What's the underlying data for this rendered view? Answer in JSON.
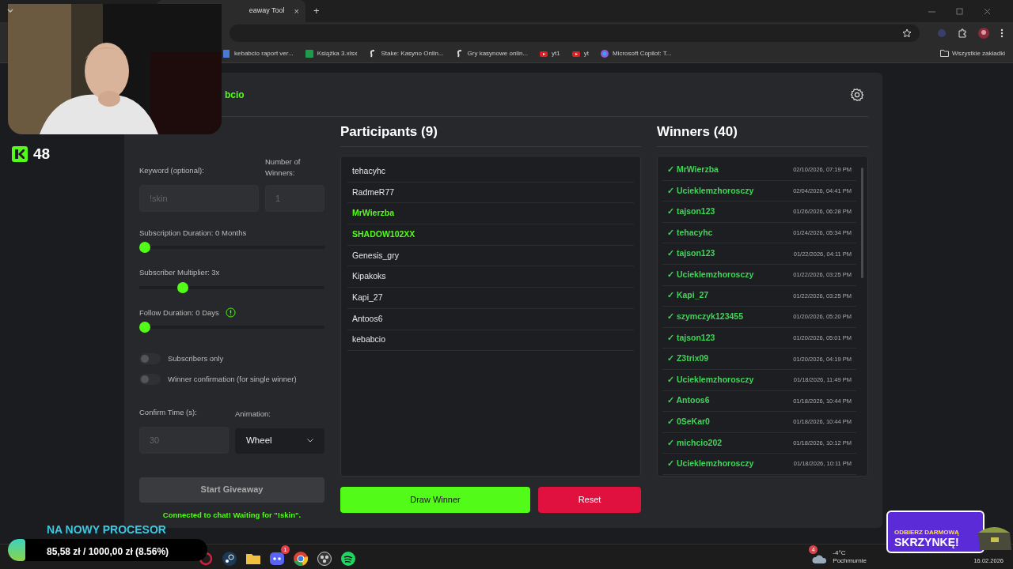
{
  "browser": {
    "tab_title": "eaway Tool",
    "tab_close": "×",
    "new_tab": "+",
    "bookmarks": [
      {
        "label": "kebabcio raport ver...",
        "kind": "doc"
      },
      {
        "label": "Książka 3.xlsx",
        "kind": "sheet"
      },
      {
        "label": "Stake: Kasyno Onlin...",
        "kind": "stake"
      },
      {
        "label": "Gry kasynowe onlin...",
        "kind": "stake"
      },
      {
        "label": "yt1",
        "kind": "video"
      },
      {
        "label": "yt",
        "kind": "video"
      },
      {
        "label": "Microsoft Copilot: T...",
        "kind": "copilot"
      }
    ],
    "all_bookmarks": "Wszystkie zakładki"
  },
  "stream_overlay": {
    "viewer_count": "48",
    "goal": {
      "title": "NA NOWY PROCESOR",
      "amount": "85,58 zł / 1000,00 zł (8.56%)",
      "level": 0.0856
    },
    "ad": {
      "line_1": "ODBIERZ DARMOWĄ",
      "line_2": "SKRZYNKĘ!"
    }
  },
  "app": {
    "channel": "bcio",
    "settings": {
      "keyword": {
        "label": "Keyword (optional):",
        "placeholder": "!skin"
      },
      "winners_count": {
        "label": "Number of Winners:",
        "placeholder": "1"
      },
      "sliders": [
        {
          "label": "Subscription Duration: 0 Months",
          "level": 0,
          "info": false
        },
        {
          "label": "Subscriber Multiplier: 3x",
          "level": 0.22,
          "info": false
        },
        {
          "label": "Follow Duration: 0 Days",
          "level": 0,
          "info": true
        }
      ],
      "toggles": [
        {
          "label": "Subscribers only",
          "on": false
        },
        {
          "label": "Winner confirmation (for single winner)",
          "on": false
        }
      ],
      "confirm_time": {
        "label": "Confirm Time (s):",
        "placeholder": "30"
      },
      "animation": {
        "label": "Animation:",
        "value": "Wheel"
      },
      "start_button": "Start Giveaway",
      "status": "Connected to chat! Waiting for \"!skin\"."
    },
    "participants": {
      "title": "Participants (9)",
      "items": [
        {
          "name": "tehacyhc",
          "winner": false
        },
        {
          "name": "RadmeR77",
          "winner": false
        },
        {
          "name": "MrWierzba",
          "winner": true
        },
        {
          "name": "SHADOW102XX",
          "winner": true
        },
        {
          "name": "Genesis_gry",
          "winner": false
        },
        {
          "name": "Kipakoks",
          "winner": false
        },
        {
          "name": "Kapi_27",
          "winner": false
        },
        {
          "name": "Antoos6",
          "winner": false
        },
        {
          "name": "kebabcio",
          "winner": false
        }
      ]
    },
    "winners": {
      "title": "Winners (40)",
      "items": [
        {
          "check": "✓",
          "name": "MrWierzba",
          "date": "02/10/2026, 07:19 PM"
        },
        {
          "check": "✓",
          "name": "Ucieklemzhorosczy",
          "date": "02/04/2026, 04:41 PM"
        },
        {
          "check": "✓",
          "name": "tajson123",
          "date": "01/26/2026, 06:28 PM"
        },
        {
          "check": "✓",
          "name": "tehacyhc",
          "date": "01/24/2026, 05:34 PM"
        },
        {
          "check": "✓",
          "name": "tajson123",
          "date": "01/22/2026, 04:11 PM"
        },
        {
          "check": "✓",
          "name": "Ucieklemzhorosczy",
          "date": "01/22/2026, 03:25 PM"
        },
        {
          "check": "✓",
          "name": "Kapi_27",
          "date": "01/22/2026, 03:25 PM"
        },
        {
          "check": "✓",
          "name": "szymczyk123455",
          "date": "01/20/2026, 05:20 PM"
        },
        {
          "check": "✓",
          "name": "tajson123",
          "date": "01/20/2026, 05:01 PM"
        },
        {
          "check": "✓",
          "name": "Z3trix09",
          "date": "01/20/2026, 04:19 PM"
        },
        {
          "check": "✓",
          "name": "Ucieklemzhorosczy",
          "date": "01/18/2026, 11:49 PM"
        },
        {
          "check": "✓",
          "name": "Antoos6",
          "date": "01/18/2026, 10:44 PM"
        },
        {
          "check": "✓",
          "name": "0SeKar0",
          "date": "01/18/2026, 10:44 PM"
        },
        {
          "check": "✓",
          "name": "michcio202",
          "date": "01/18/2026, 10:12 PM"
        },
        {
          "check": "✓",
          "name": "Ucieklemzhorosczy",
          "date": "01/18/2026, 10:11 PM"
        }
      ]
    },
    "draw_button": "Draw Winner",
    "reset_button": "Reset"
  },
  "taskbar": {
    "apps": [
      {
        "kind": "ring"
      },
      {
        "kind": "steam"
      },
      {
        "kind": "folder"
      },
      {
        "kind": "discord",
        "badge": "1"
      },
      {
        "kind": "chrome"
      },
      {
        "kind": "obs"
      },
      {
        "kind": "spotify"
      }
    ],
    "weather": {
      "badge": "4",
      "temp": "-4°C",
      "condition": "Pochmurnie"
    },
    "date": "16.02.2026"
  }
}
